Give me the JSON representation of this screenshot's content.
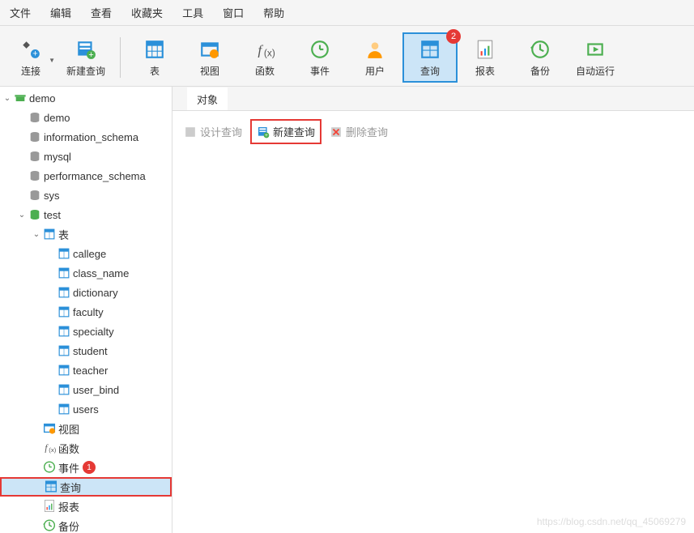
{
  "menu": [
    "文件",
    "编辑",
    "查看",
    "收藏夹",
    "工具",
    "窗口",
    "帮助"
  ],
  "toolbar": [
    {
      "label": "连接",
      "icon": "plug",
      "dropdown": true
    },
    {
      "label": "新建查询",
      "icon": "new-query"
    },
    {
      "sep": true
    },
    {
      "label": "表",
      "icon": "table"
    },
    {
      "label": "视图",
      "icon": "view"
    },
    {
      "label": "函数",
      "icon": "fx"
    },
    {
      "label": "事件",
      "icon": "clock"
    },
    {
      "label": "用户",
      "icon": "user"
    },
    {
      "label": "查询",
      "icon": "query",
      "selected": true,
      "badge": "2"
    },
    {
      "label": "报表",
      "icon": "report"
    },
    {
      "label": "备份",
      "icon": "backup"
    },
    {
      "label": "自动运行",
      "icon": "auto"
    }
  ],
  "sidebar": {
    "connection": "demo",
    "databases": [
      "demo",
      "information_schema",
      "mysql",
      "performance_schema",
      "sys"
    ],
    "active_db": "test",
    "groups": {
      "tables": {
        "label": "表",
        "items": [
          "callege",
          "class_name",
          "dictionary",
          "faculty",
          "specialty",
          "student",
          "teacher",
          "user_bind",
          "users"
        ]
      },
      "views": {
        "label": "视图",
        "icon": "view"
      },
      "functions": {
        "label": "函数",
        "icon": "fx"
      },
      "events": {
        "label": "事件",
        "icon": "clock",
        "badge": "1"
      },
      "queries": {
        "label": "查询",
        "icon": "query",
        "selected": true,
        "highlight": true
      },
      "reports": {
        "label": "报表",
        "icon": "report"
      },
      "backups": {
        "label": "备份",
        "icon": "backup"
      }
    }
  },
  "content": {
    "tab": "对象",
    "buttons": [
      {
        "label": "设计查询",
        "icon": "design",
        "disabled": true
      },
      {
        "label": "新建查询",
        "icon": "new-query",
        "highlight": true,
        "active": true
      },
      {
        "label": "删除查询",
        "icon": "delete",
        "disabled": true
      }
    ]
  },
  "watermark": "https://blog.csdn.net/qq_45069279"
}
